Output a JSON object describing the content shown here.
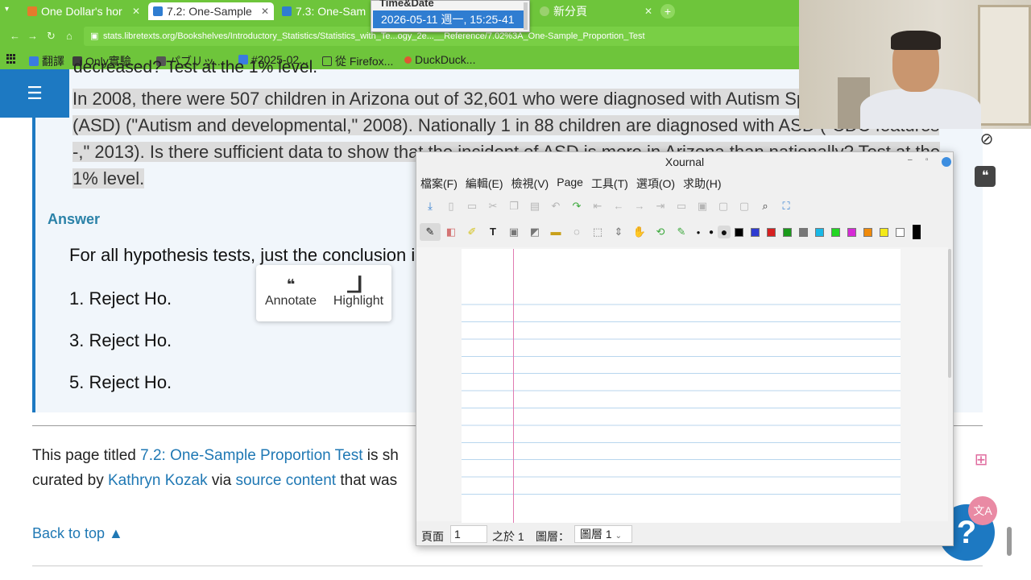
{
  "browser": {
    "tabs": [
      {
        "title": "One Dollar's hor",
        "active": false
      },
      {
        "title": "7.2: One-Sample",
        "active": true
      },
      {
        "title": "7.3: One-Samp",
        "active": false
      },
      {
        "title": "新分頁",
        "active": false
      }
    ],
    "url": "stats.libretexts.org/Bookshelves/Introductory_Statistics/Statistics_with_Te...ogy_2e...__Reference/7.02%3A_One-Sample_Proportion_Test",
    "bookmarks": [
      "翻譯",
      "Only實驗...",
      "パブリッ...",
      "#2025-02...",
      "從 Firefox...",
      "DuckDuck..."
    ]
  },
  "clock_popup": {
    "heading": "Time&Date",
    "value": "2026-05-11 週一, 15:25-41"
  },
  "page": {
    "question_top": "decreased? Test at the 1% level.",
    "question": "In 2008, there were 507 children in Arizona out of 32,601 who were diagnosed with Autism Spectrum Disorder (ASD) (\"Autism and developmental,\" 2008). Nationally 1 in 88 children are diagnosed with ASD (\"CDC features -,\" 2013). Is there sufficient data to show that the incident of ASD is more in Arizona than nationally? Test at the 1% level.",
    "answer_heading": "Answer",
    "answer_intro": "For all hypothesis tests, just the conclusion is given.",
    "answers": [
      "1. Reject Ho.",
      "3. Reject Ho.",
      "5. Reject Ho."
    ],
    "license_prefix": "This page titled ",
    "license_link": "7.2: One-Sample Proportion Test",
    "license_mid": " is sh",
    "license_line2_prefix": "curated by ",
    "author": "Kathryn Kozak",
    "via": " via ",
    "source": "source content",
    "license_line2_suffix": " that was",
    "back_to_top": "Back to top ▲",
    "annotate_label": "Annotate",
    "highlight_label": "Highlight"
  },
  "xournal": {
    "title": "Xournal",
    "menu": [
      "檔案(F)",
      "編輯(E)",
      "檢視(V)",
      "Page",
      "工具(T)",
      "選項(O)",
      "求助(H)"
    ],
    "colors": [
      "#000000",
      "#2e3bd1",
      "#d62020",
      "#1a9a1a",
      "#777777",
      "#19b8e6",
      "#22d622",
      "#d62ad6",
      "#f08a0a",
      "#f4ea18",
      "#ffffff"
    ],
    "status": {
      "page_label": "頁面",
      "page_value": "1",
      "of_label": "之於 1",
      "layer_label": "圖層：",
      "layer_value": "圖層 1"
    }
  }
}
